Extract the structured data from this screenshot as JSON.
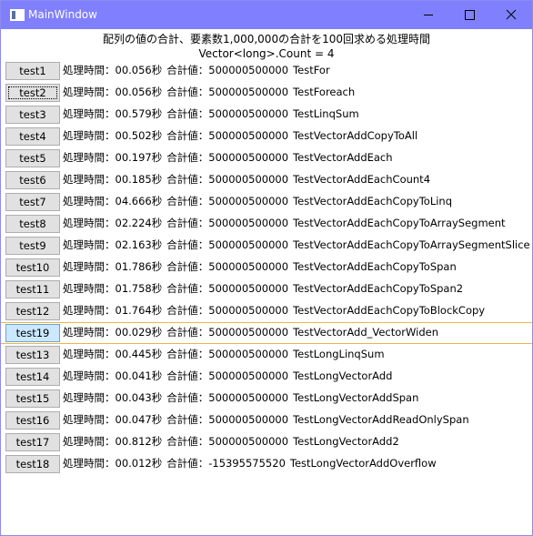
{
  "window": {
    "title": "MainWindow",
    "colors": {
      "titlebar": "#8080ff",
      "selected_border": "#e7b84a",
      "active_button": "#cce8ff"
    }
  },
  "header": {
    "line1": "配列の値の合計、要素数1,000,000の合計を100回求める処理時間",
    "line2": "Vector<long>.Count = 4"
  },
  "rows": [
    {
      "button": "test1",
      "time": "処理時間：00.056秒",
      "sum": "合計値：500000500000",
      "name": "TestFor"
    },
    {
      "button": "test2",
      "time": "処理時間：00.056秒",
      "sum": "合計値：500000500000",
      "name": "TestForeach"
    },
    {
      "button": "test3",
      "time": "処理時間：00.579秒",
      "sum": "合計値：500000500000",
      "name": "TestLinqSum"
    },
    {
      "button": "test4",
      "time": "処理時間：00.502秒",
      "sum": "合計値：500000500000",
      "name": "TestVectorAddCopyToAll"
    },
    {
      "button": "test5",
      "time": "処理時間：00.197秒",
      "sum": "合計値：500000500000",
      "name": "TestVectorAddEach"
    },
    {
      "button": "test6",
      "time": "処理時間：00.185秒",
      "sum": "合計値：500000500000",
      "name": "TestVectorAddEachCount4"
    },
    {
      "button": "test7",
      "time": "処理時間：04.666秒",
      "sum": "合計値：500000500000",
      "name": "TestVectorAddEachCopyToLinq"
    },
    {
      "button": "test8",
      "time": "処理時間：02.224秒",
      "sum": "合計値：500000500000",
      "name": "TestVectorAddEachCopyToArraySegment"
    },
    {
      "button": "test9",
      "time": "処理時間：02.163秒",
      "sum": "合計値：500000500000",
      "name": "TestVectorAddEachCopyToArraySegmentSlice"
    },
    {
      "button": "test10",
      "time": "処理時間：01.786秒",
      "sum": "合計値：500000500000",
      "name": "TestVectorAddEachCopyToSpan"
    },
    {
      "button": "test11",
      "time": "処理時間：01.758秒",
      "sum": "合計値：500000500000",
      "name": "TestVectorAddEachCopyToSpan2"
    },
    {
      "button": "test12",
      "time": "処理時間：01.764秒",
      "sum": "合計値：500000500000",
      "name": "TestVectorAddEachCopyToBlockCopy"
    },
    {
      "button": "test19",
      "time": "処理時間：00.029秒",
      "sum": "合計値：500000500000",
      "name": "TestVectorAdd_VectorWiden"
    },
    {
      "button": "test13",
      "time": "処理時間：00.445秒",
      "sum": "合計値：500000500000",
      "name": "TestLongLinqSum"
    },
    {
      "button": "test14",
      "time": "処理時間：00.041秒",
      "sum": "合計値：500000500000",
      "name": "TestLongVectorAdd"
    },
    {
      "button": "test15",
      "time": "処理時間：00.043秒",
      "sum": "合計値：500000500000",
      "name": "TestLongVectorAddSpan"
    },
    {
      "button": "test16",
      "time": "処理時間：00.047秒",
      "sum": "合計値：500000500000",
      "name": "TestLongVectorAddReadOnlySpan"
    },
    {
      "button": "test17",
      "time": "処理時間：00.812秒",
      "sum": "合計値：500000500000",
      "name": "TestLongVectorAdd2"
    },
    {
      "button": "test18",
      "time": "処理時間：00.012秒",
      "sum": "合計値：-15395575520",
      "name": "TestLongVectorAddOverflow"
    }
  ]
}
